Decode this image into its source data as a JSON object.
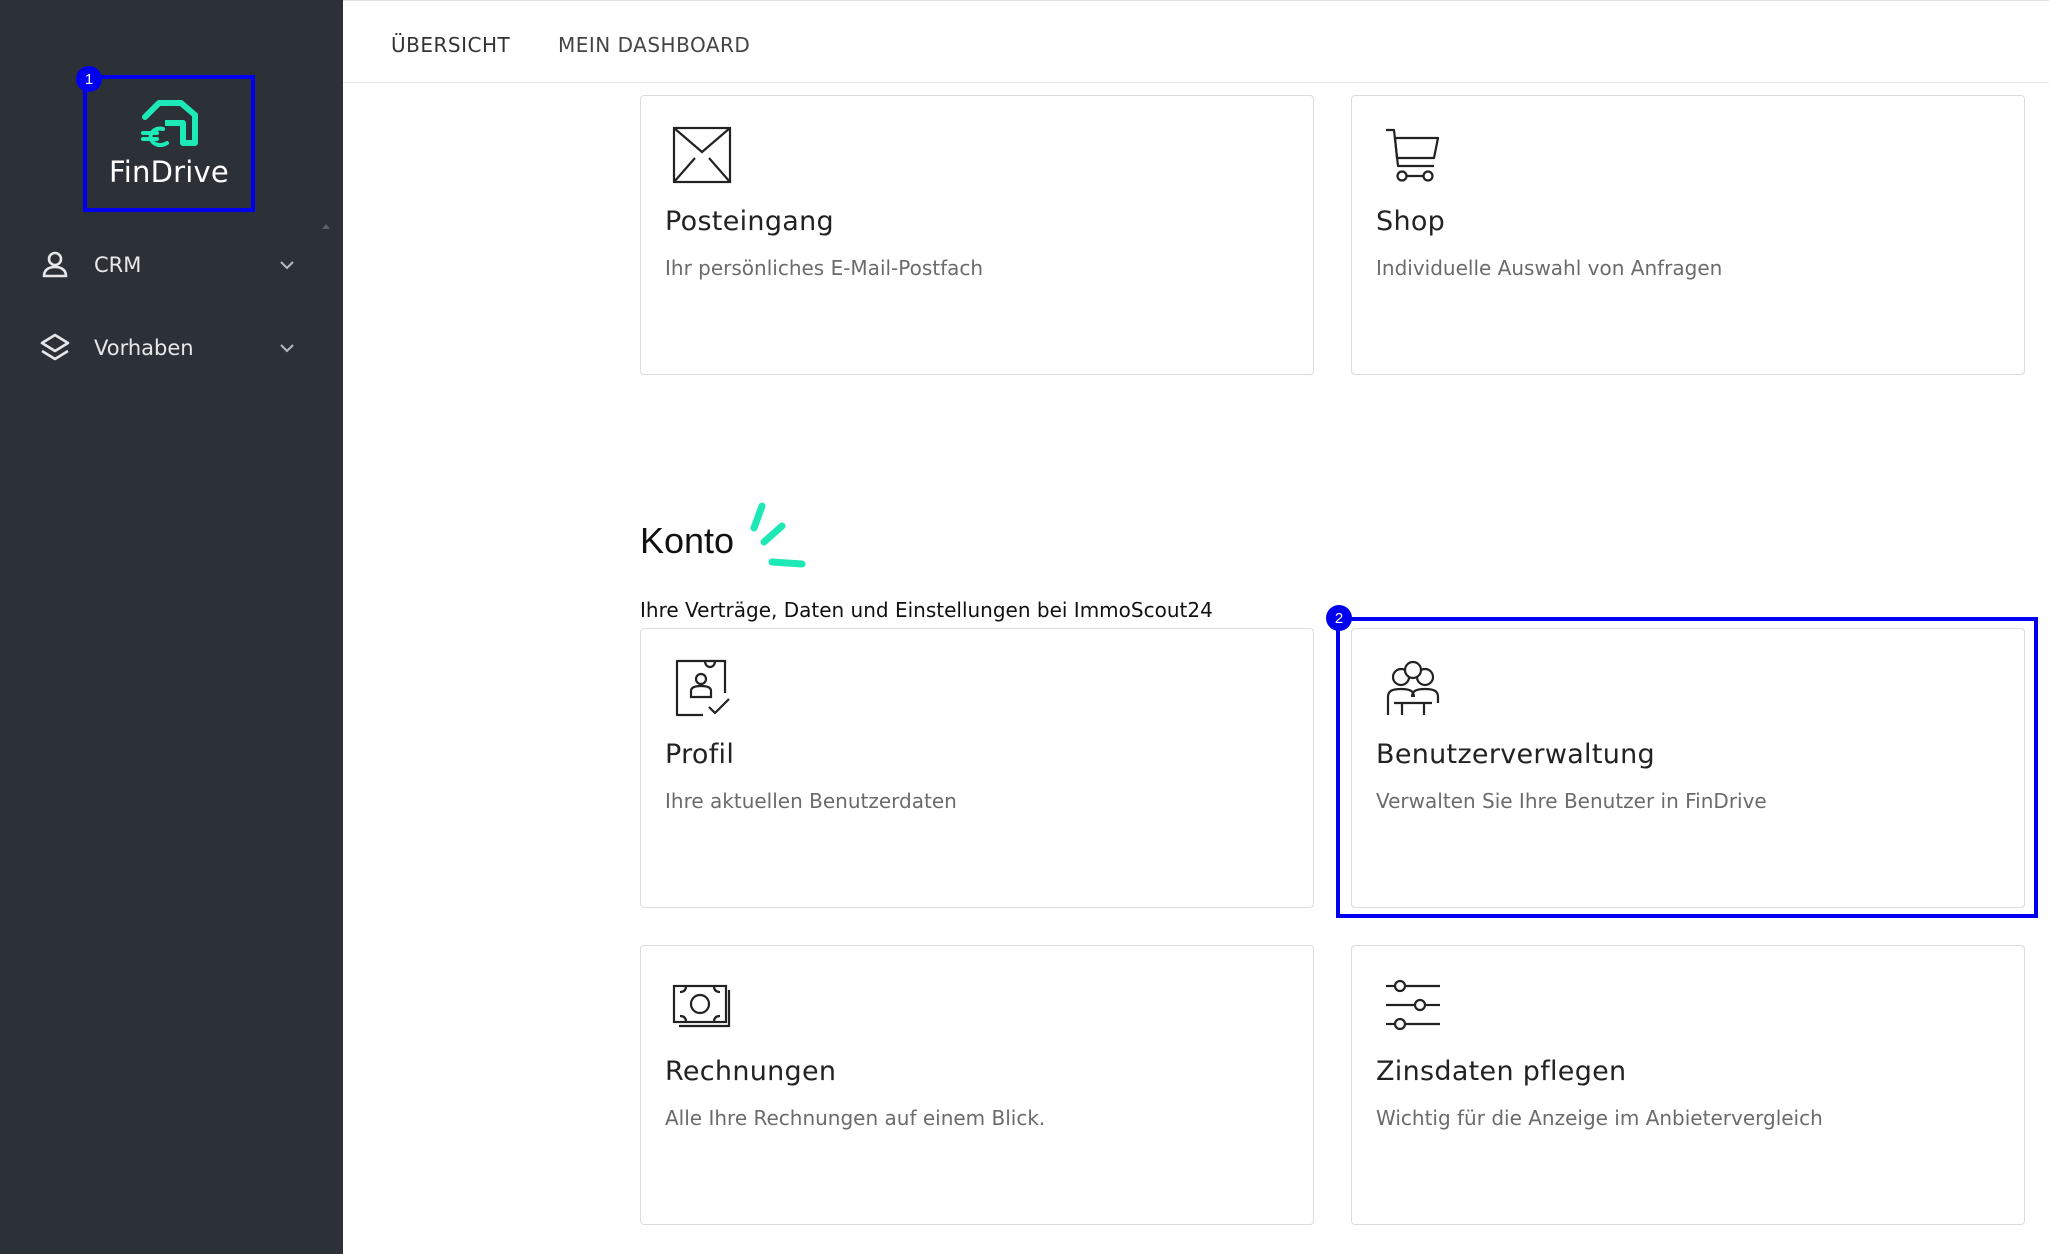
{
  "sidebar": {
    "logo_text": "FinDrive",
    "items": [
      {
        "label": "CRM",
        "icon": "person-icon"
      },
      {
        "label": "Vorhaben",
        "icon": "layers-icon"
      }
    ]
  },
  "badges": {
    "first": "1",
    "second": "2"
  },
  "header": {
    "tabs": [
      {
        "label": "ÜBERSICHT"
      },
      {
        "label": "MEIN DASHBOARD"
      }
    ]
  },
  "cards_top": [
    {
      "title": "Posteingang",
      "desc": "Ihr persönliches E-Mail-Postfach",
      "icon": "envelope-icon"
    },
    {
      "title": "Shop",
      "desc": "Individuelle Auswahl von Anfragen",
      "icon": "cart-icon"
    }
  ],
  "section": {
    "title": "Konto",
    "subtitle": "Ihre Verträge, Daten und Einstellungen bei ImmoScout24"
  },
  "cards_konto": [
    {
      "title": "Profil",
      "desc": "Ihre aktuellen Benutzerdaten",
      "icon": "profile-document-icon"
    },
    {
      "title": "Benutzerverwaltung",
      "desc": "Verwalten Sie Ihre Benutzer in FinDrive",
      "icon": "users-group-icon"
    },
    {
      "title": "Rechnungen",
      "desc": "Alle Ihre Rechnungen auf einem Blick.",
      "icon": "banknote-icon"
    },
    {
      "title": "Zinsdaten pflegen",
      "desc": "Wichtig für die Anzeige im Anbietervergleich",
      "icon": "sliders-icon"
    }
  ],
  "colors": {
    "sidebar_bg": "#2c3138",
    "accent": "#1de9b6",
    "highlight": "#0000ee"
  }
}
